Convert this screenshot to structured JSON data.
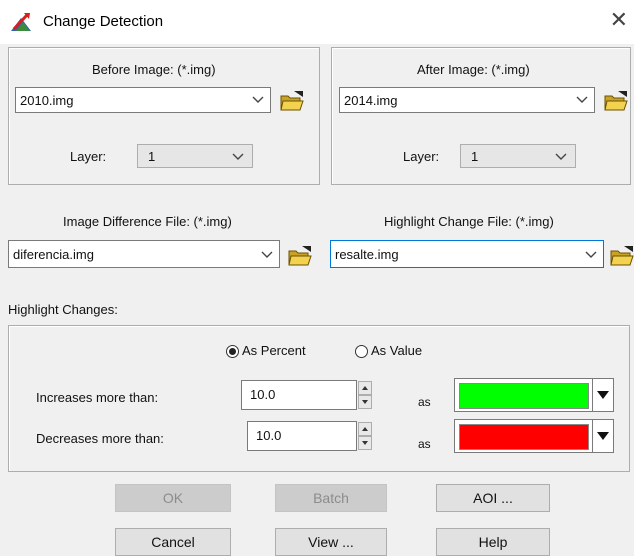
{
  "window": {
    "title": "Change Detection",
    "close_glyph": "✕",
    "icon": "change-detection-icon"
  },
  "before": {
    "label": "Before Image: (*.img)",
    "file": "2010.img",
    "layer_label": "Layer:",
    "layer": "1"
  },
  "after": {
    "label": "After Image: (*.img)",
    "file": "2014.img",
    "layer_label": "Layer:",
    "layer": "1"
  },
  "difference": {
    "label": "Image Difference File: (*.img)",
    "file": "diferencia.img"
  },
  "highlight_file": {
    "label": "Highlight Change File: (*.img)",
    "file": "resalte.img"
  },
  "highlight": {
    "section_label": "Highlight Changes:",
    "mode_percent": "As Percent",
    "mode_value": "As Value",
    "selected_mode": "percent",
    "increase_label": "Increases more than:",
    "increase_value": "10.0",
    "increase_as": "as",
    "increase_color": "#00ff00",
    "decrease_label": "Decreases more than:",
    "decrease_value": "10.0",
    "decrease_as": "as",
    "decrease_color": "#ff0000"
  },
  "buttons": {
    "ok": "OK",
    "batch": "Batch",
    "aoi": "AOI ...",
    "cancel": "Cancel",
    "view": "View ...",
    "help": "Help"
  }
}
